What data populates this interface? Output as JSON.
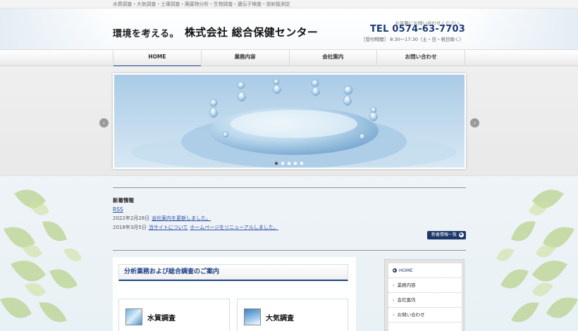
{
  "topbar": {
    "services": "水質調査・大気調査・土壌調査・廃棄物分析・生物調査・遺伝子検査・放射能測定"
  },
  "header": {
    "catchphrase": "環境を考える。",
    "company_name": "株式会社 総合保健センター",
    "contact_note": "お気軽にお問い合わせください。",
    "tel": "TEL 0574-63-7703",
    "hours": "［受付時間］ 8:30〜17:30（土・日・祝日除く）"
  },
  "nav": {
    "items": [
      {
        "label": "HOME",
        "active": true
      },
      {
        "label": "業務内容",
        "active": false
      },
      {
        "label": "会社案内",
        "active": false
      },
      {
        "label": "お問い合わせ",
        "active": false
      }
    ]
  },
  "slider": {
    "prev_icon": "chevron-left-icon",
    "next_icon": "chevron-right-icon",
    "dot_count": 5,
    "active_dot": 0
  },
  "news": {
    "title": "新着情報",
    "rss": "RSS",
    "items": [
      {
        "date": "2022年2月28日",
        "links": [
          "会社案内を更新しました。"
        ]
      },
      {
        "date": "2018年3月5日",
        "links": [
          "当サイトについて",
          "ホームページをリニューアルしました。"
        ]
      }
    ],
    "list_button": "新着情報一覧"
  },
  "main": {
    "section_title": "分析業務および総合調査のご案内",
    "cards": [
      {
        "label": "水質調査"
      },
      {
        "label": "大気調査"
      }
    ]
  },
  "sidebar": {
    "items": [
      {
        "label": "HOME",
        "active": true
      },
      {
        "label": "業務内容",
        "active": false
      },
      {
        "label": "会社案内",
        "active": false
      },
      {
        "label": "お問い合わせ",
        "active": false
      }
    ]
  },
  "colors": {
    "brand_navy": "#1d3f86",
    "link_blue": "#2b4fa8",
    "button_navy": "#1d3868"
  }
}
